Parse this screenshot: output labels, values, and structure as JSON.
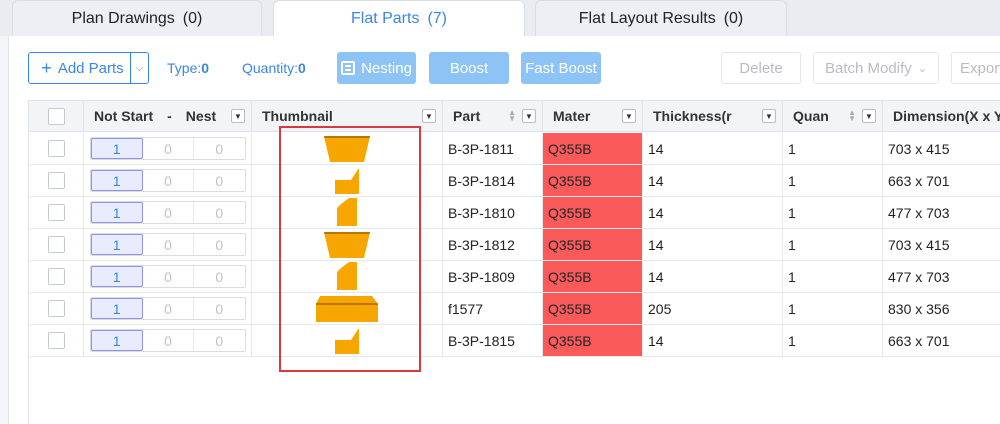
{
  "tabs": [
    {
      "label": "Plan Drawings",
      "count": "(0)"
    },
    {
      "label": "Flat Parts",
      "count": "(7)"
    },
    {
      "label": "Flat Layout Results",
      "count": "(0)"
    }
  ],
  "toolbar": {
    "add_parts": "Add Parts",
    "type_label": "Type:",
    "type_value": "0",
    "quantity_label": "Quantity:",
    "quantity_value": "0",
    "nesting": "Nesting",
    "boost": "Boost",
    "fast_boost": "Fast Boost",
    "delete": "Delete",
    "batch_modify": "Batch Modify",
    "export": "Export"
  },
  "columns": {
    "not_start": "Not Start",
    "dash": "-",
    "nest": "Nest",
    "thumbnail": "Thumbnail",
    "part": "Part",
    "material": "Mater",
    "thickness": "Thickness(r",
    "quantity": "Quan",
    "dimension": "Dimension(X x Y"
  },
  "rows": [
    {
      "not_start": "1",
      "nest": "0",
      "done": "0",
      "shape": "trapezoid",
      "part": "B-3P-1811",
      "material": "Q355B",
      "thickness": "14",
      "quantity": "1",
      "dimension": "703 x 415"
    },
    {
      "not_start": "1",
      "nest": "0",
      "done": "0",
      "shape": "l-notch",
      "part": "B-3P-1814",
      "material": "Q355B",
      "thickness": "14",
      "quantity": "1",
      "dimension": "663 x 701"
    },
    {
      "not_start": "1",
      "nest": "0",
      "done": "0",
      "shape": "tall-chamfer",
      "part": "B-3P-1810",
      "material": "Q355B",
      "thickness": "14",
      "quantity": "1",
      "dimension": "477 x 703"
    },
    {
      "not_start": "1",
      "nest": "0",
      "done": "0",
      "shape": "trapezoid",
      "part": "B-3P-1812",
      "material": "Q355B",
      "thickness": "14",
      "quantity": "1",
      "dimension": "703 x 415"
    },
    {
      "not_start": "1",
      "nest": "0",
      "done": "0",
      "shape": "tall-chamfer",
      "part": "B-3P-1809",
      "material": "Q355B",
      "thickness": "14",
      "quantity": "1",
      "dimension": "477 x 703"
    },
    {
      "not_start": "1",
      "nest": "0",
      "done": "0",
      "shape": "wide-plate",
      "part": "f1577",
      "material": "Q355B",
      "thickness": "205",
      "quantity": "1",
      "dimension": "830 x 356"
    },
    {
      "not_start": "1",
      "nest": "0",
      "done": "0",
      "shape": "l-notch",
      "part": "B-3P-1815",
      "material": "Q355B",
      "thickness": "14",
      "quantity": "1",
      "dimension": "663 x 701"
    }
  ],
  "colors": {
    "accent": "#3a86e8",
    "material_highlight": "#fa5a5a",
    "thumbnail_fill": "#f7a600",
    "highlight_box": "#d63a3a"
  }
}
